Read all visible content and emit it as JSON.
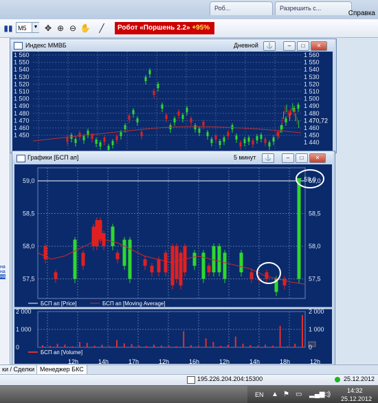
{
  "tabs": {
    "tab1": "Роб...",
    "tab2": "Разрешить с...",
    "help": "Справка"
  },
  "toolbar": {
    "timeframe": "M5",
    "robot_label": "Робот «Поршень 2.2»",
    "robot_percent": "+95%"
  },
  "mmvb_window": {
    "title": "Индекс ММВБ",
    "period": "Дневной",
    "y_ticks": [
      "1 560",
      "1 550",
      "1 540",
      "1 530",
      "1 520",
      "1 510",
      "1 500",
      "1 490",
      "1 480",
      "1 470",
      "1 460",
      "1 450"
    ],
    "right_ticks": [
      "1 560",
      "1 550",
      "1 540",
      "1 530",
      "1 520",
      "1 510",
      "1 500",
      "1 490",
      "1 480",
      "1 470,72",
      "1 460",
      "1 450",
      "1 440"
    ]
  },
  "bsp_window": {
    "title": "Графики [БСП ап]",
    "period": "5 минут",
    "price_ticks": [
      "59,0",
      "58,5",
      "58,0",
      "57,5"
    ],
    "right_price_ticks": [
      "59,0",
      "58,5",
      "58,0",
      "57,5"
    ],
    "legend_price": "БСП ап [Price]",
    "legend_ma": "БСП ап [Moving Average]",
    "volume_ticks": [
      "2 000",
      "1 000",
      "0"
    ],
    "legend_volume": "БСП ап [Volume]",
    "x_labels": [
      "12h",
      "14h",
      "17h",
      "12h",
      "16h",
      "12h",
      "14h",
      "18h",
      "12h"
    ]
  },
  "bottom_tabs": {
    "deals": "ки / Сделки",
    "manager": "Менеджер БКС"
  },
  "status": {
    "ip": "195.226.204.204:15300",
    "date": "25.12.2012"
  },
  "taskbar": {
    "lang": "EN",
    "time": "14:32",
    "date": "25.12.2012"
  },
  "chart_data": [
    {
      "type": "line",
      "title": "Индекс ММВБ",
      "ylim": [
        1440,
        1560
      ],
      "note_series": "candles"
    },
    {
      "type": "bar",
      "title": "Графики [БСП ап]",
      "series": [
        {
          "name": "БСП ап [Price]",
          "values": []
        },
        {
          "name": "БСП ап [Moving Average]",
          "values": []
        },
        {
          "name": "БСП ап [Volume]",
          "values": []
        }
      ],
      "ylim": [
        57.2,
        59.2
      ],
      "volume_ylim": [
        0,
        2000
      ]
    }
  ]
}
